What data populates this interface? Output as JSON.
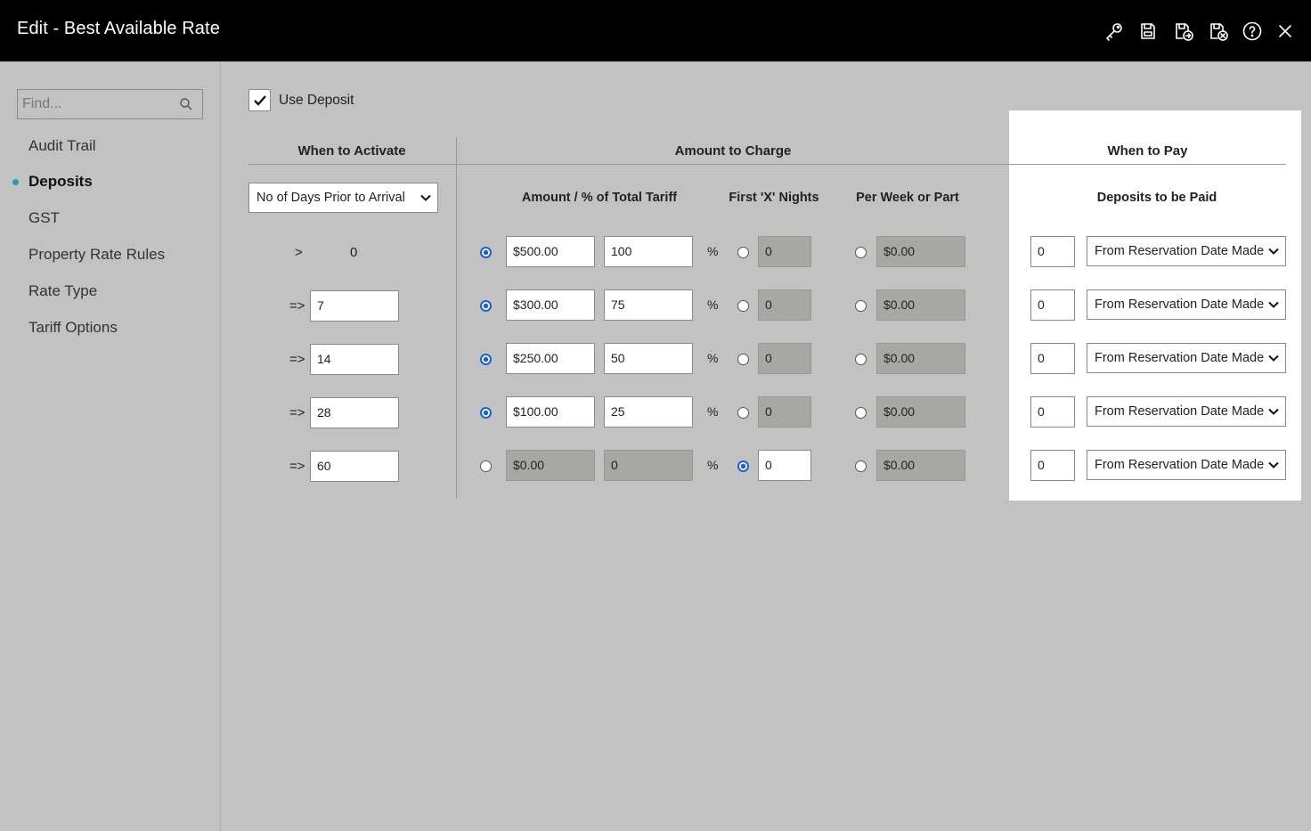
{
  "window": {
    "title": "Edit - Best Available Rate"
  },
  "toolbar": [
    {
      "name": "key-icon"
    },
    {
      "name": "save-icon"
    },
    {
      "name": "save-and-exit-icon"
    },
    {
      "name": "save-and-close-icon"
    },
    {
      "name": "help-icon"
    },
    {
      "name": "close-icon"
    }
  ],
  "sidebar": {
    "search_placeholder": "Find...",
    "items": [
      {
        "label": "Audit Trail",
        "active": false
      },
      {
        "label": "Deposits",
        "active": true
      },
      {
        "label": "GST",
        "active": false
      },
      {
        "label": "Property Rate Rules",
        "active": false
      },
      {
        "label": "Rate Type",
        "active": false
      },
      {
        "label": "Tariff Options",
        "active": false
      }
    ]
  },
  "deposit": {
    "use_deposit_label": "Use Deposit",
    "use_deposit_checked": true,
    "headers": {
      "when_to_activate": "When to Activate",
      "amount_to_charge": "Amount to Charge",
      "when_to_pay": "When to Pay",
      "amount_pct": "Amount / % of Total Tariff",
      "first_x_nights": "First 'X' Nights",
      "per_week": "Per Week or Part",
      "deposits_to_be_paid": "Deposits to be Paid"
    },
    "activate_select": "No of Days Prior to Arrival",
    "pct_symbol": "%",
    "rows": [
      {
        "op": ">",
        "days": "0",
        "days_editable": false,
        "amount": "$500.00",
        "pct": "100",
        "nights": "0",
        "per_week": "$0.00",
        "mode": "amount",
        "pay_days": "0",
        "pay_from": "From Reservation Date Made"
      },
      {
        "op": "=>",
        "days": "7",
        "days_editable": true,
        "amount": "$300.00",
        "pct": "75",
        "nights": "0",
        "per_week": "$0.00",
        "mode": "amount",
        "pay_days": "0",
        "pay_from": "From Reservation Date Made"
      },
      {
        "op": "=>",
        "days": "14",
        "days_editable": true,
        "amount": "$250.00",
        "pct": "50",
        "nights": "0",
        "per_week": "$0.00",
        "mode": "amount",
        "pay_days": "0",
        "pay_from": "From Reservation Date Made"
      },
      {
        "op": "=>",
        "days": "28",
        "days_editable": true,
        "amount": "$100.00",
        "pct": "25",
        "nights": "0",
        "per_week": "$0.00",
        "mode": "amount",
        "pay_days": "0",
        "pay_from": "From Reservation Date Made"
      },
      {
        "op": "=>",
        "days": "60",
        "days_editable": true,
        "amount": "$0.00",
        "pct": "0",
        "nights": "0",
        "per_week": "$0.00",
        "mode": "nights",
        "pay_days": "0",
        "pay_from": "From Reservation Date Made"
      }
    ]
  },
  "colors": {
    "titlebar": "#000000",
    "background": "#c2c2c2",
    "accent_dot": "#1aa1ad",
    "radio_on": "#1f5fd6",
    "disabled_field": "#a7a7a3"
  }
}
